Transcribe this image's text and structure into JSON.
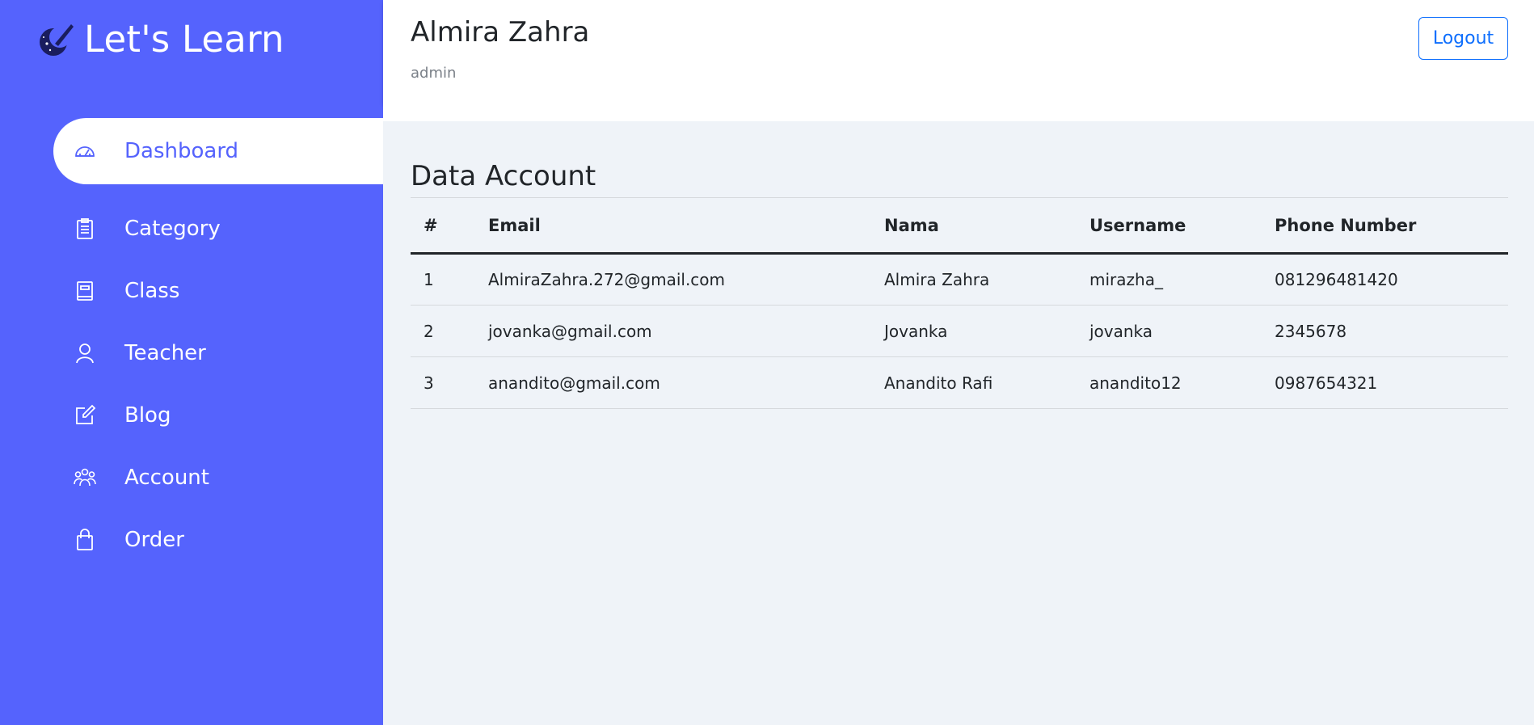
{
  "brand": {
    "title": "Let's Learn",
    "logo": "paintbrush-moon-logo"
  },
  "sidebar": {
    "items": [
      {
        "label": "Dashboard",
        "icon": "gauge-icon",
        "active": true
      },
      {
        "label": "Category",
        "icon": "clipboard-icon",
        "active": false
      },
      {
        "label": "Class",
        "icon": "book-icon",
        "active": false
      },
      {
        "label": "Teacher",
        "icon": "person-icon",
        "active": false
      },
      {
        "label": "Blog",
        "icon": "edit-icon",
        "active": false
      },
      {
        "label": "Account",
        "icon": "people-icon",
        "active": false
      },
      {
        "label": "Order",
        "icon": "bag-icon",
        "active": false
      }
    ]
  },
  "header": {
    "user_name": "Almira Zahra",
    "user_role": "admin",
    "logout_label": "Logout"
  },
  "main": {
    "title": "Data Account",
    "columns": [
      "#",
      "Email",
      "Nama",
      "Username",
      "Phone Number"
    ],
    "rows": [
      [
        "1",
        "AlmiraZahra.272@gmail.com",
        "Almira Zahra",
        "mirazha_",
        "081296481420"
      ],
      [
        "2",
        "jovanka@gmail.com",
        "Jovanka",
        "jovanka",
        "2345678"
      ],
      [
        "3",
        "anandito@gmail.com",
        "Anandito Rafi",
        "anandito12",
        "0987654321"
      ]
    ]
  },
  "colors": {
    "sidebar_bg": "#5563fd",
    "accent": "#0d6efd",
    "page_bg": "#eff3f8"
  }
}
